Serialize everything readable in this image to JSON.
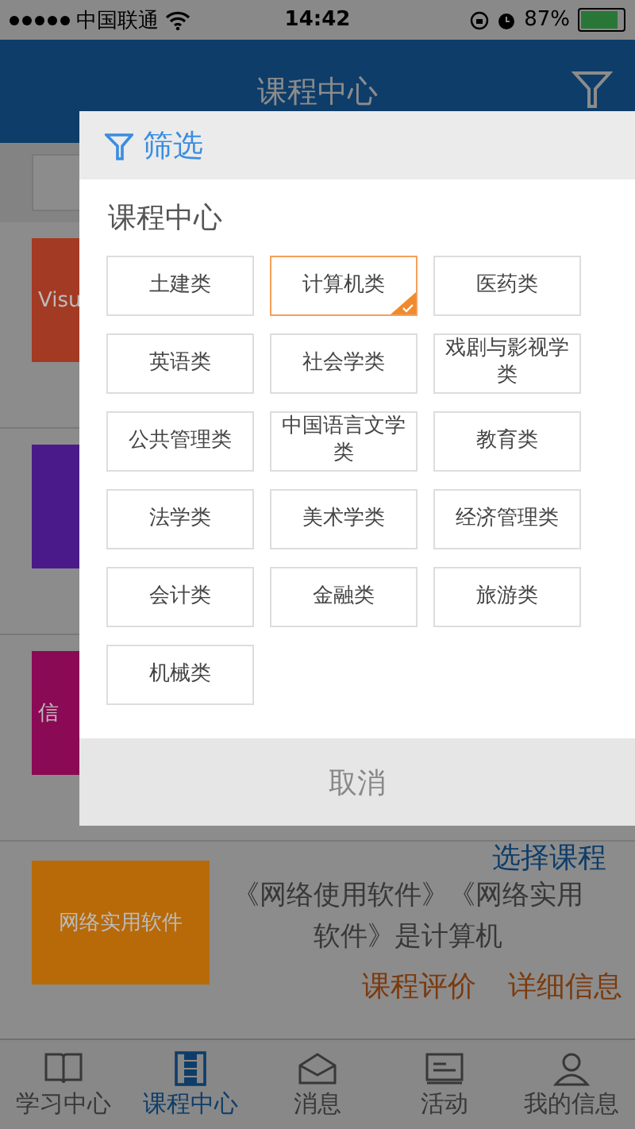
{
  "status_bar": {
    "carrier": "中国联通",
    "time": "14:42",
    "battery": "87%"
  },
  "header": {
    "title": "课程中心"
  },
  "courses": [
    {
      "tile": "Visu",
      "color": "#a33a24"
    },
    {
      "color": "#4a1a8a"
    },
    {
      "tile": "信",
      "color": "#8a0a55"
    },
    {
      "tile": "网络实用软件",
      "color": "#b86a08",
      "action": "选择课程",
      "description": "《网络使用软件》《网络实用软件》是计算机",
      "links": [
        "课程评价",
        "详细信息"
      ]
    }
  ],
  "filter_dialog": {
    "title": "筛选",
    "section": "课程中心",
    "cancel": "取消",
    "options": [
      {
        "label": "土建类",
        "selected": false
      },
      {
        "label": "计算机类",
        "selected": true
      },
      {
        "label": "医药类",
        "selected": false
      },
      {
        "label": "英语类",
        "selected": false
      },
      {
        "label": "社会学类",
        "selected": false
      },
      {
        "label": "戏剧与影视学类",
        "selected": false
      },
      {
        "label": "公共管理类",
        "selected": false
      },
      {
        "label": "中国语言文学类",
        "selected": false
      },
      {
        "label": "教育类",
        "selected": false
      },
      {
        "label": "法学类",
        "selected": false
      },
      {
        "label": "美术学类",
        "selected": false
      },
      {
        "label": "经济管理类",
        "selected": false
      },
      {
        "label": "会计类",
        "selected": false
      },
      {
        "label": "金融类",
        "selected": false
      },
      {
        "label": "旅游类",
        "selected": false
      },
      {
        "label": "机械类",
        "selected": false
      }
    ]
  },
  "tab_bar": [
    {
      "label": "学习中心",
      "selected": false
    },
    {
      "label": "课程中心",
      "selected": true
    },
    {
      "label": "消息",
      "selected": false
    },
    {
      "label": "活动",
      "selected": false
    },
    {
      "label": "我的信息",
      "selected": false
    }
  ]
}
